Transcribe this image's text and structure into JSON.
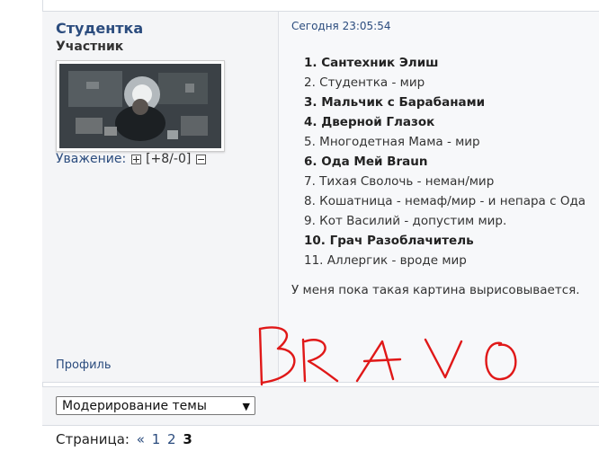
{
  "post": {
    "username": "Студентка",
    "rank": "Участник",
    "respect_label": "Уважение:",
    "respect_score": "[+8/-0]",
    "profile_label": "Профиль",
    "date": "Сегодня 23:05:54",
    "list": [
      {
        "text": "1. Сантехник Элиш",
        "bold": true
      },
      {
        "text": "2. Студентка - мир",
        "bold": false
      },
      {
        "text": "3. Мальчик с Барабанами",
        "bold": true
      },
      {
        "text": "4. Дверной Глазок",
        "bold": true
      },
      {
        "text": "5. Многодетная Мама - мир",
        "bold": false
      },
      {
        "text": "6. Ода Мей Braun",
        "bold": true
      },
      {
        "text": "7. Тихая Сволочь - неман/мир",
        "bold": false
      },
      {
        "text": "8. Кошатница - немаф/мир - и непара с Ода",
        "bold": false
      },
      {
        "text": "9. Кот Василий - допустим мир.",
        "bold": false
      },
      {
        "text": "10. Грач Разоблачитель",
        "bold": true
      },
      {
        "text": "11. Аллергик - вроде мир",
        "bold": false
      }
    ],
    "summary": "У меня пока такая картина вырисовывается.",
    "handwriting": "BRAVO",
    "handwriting_color": "#e01818"
  },
  "moderation": {
    "selected": "Модерирование темы"
  },
  "pagination": {
    "label": "Страница:",
    "prev": "«",
    "pages": [
      "1",
      "2"
    ],
    "current": "3"
  },
  "colors": {
    "link": "#2b4c7e",
    "post_bg": "#f4f5f7"
  }
}
